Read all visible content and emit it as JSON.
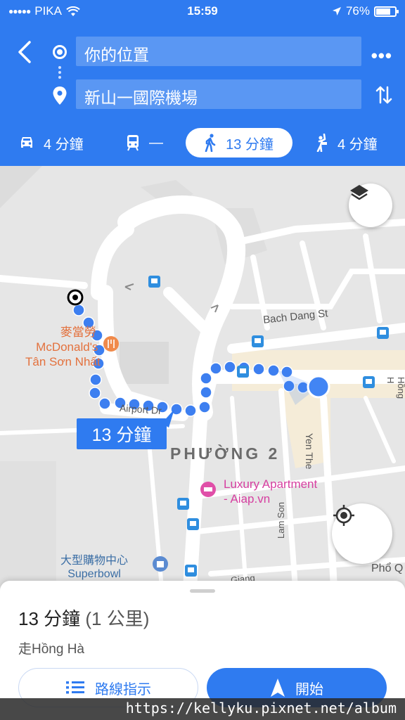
{
  "status_bar": {
    "carrier": "PIKA",
    "time": "15:59",
    "battery": "76%",
    "battery_level": 0.76
  },
  "header": {
    "origin": "你的位置",
    "destination": "新山一國際機場",
    "back_icon": "chevron-left-icon",
    "more_icon": "more-horizontal-icon",
    "swap_icon": "swap-vertical-icon"
  },
  "modes": [
    {
      "icon": "car-icon",
      "label": "4 分鐘"
    },
    {
      "icon": "transit-icon",
      "label": "—"
    },
    {
      "icon": "walk-icon",
      "label": "13 分鐘",
      "selected": true
    },
    {
      "icon": "ride-hailing-icon",
      "label": "4 分鐘"
    }
  ],
  "map": {
    "route_duration": "13 分鐘",
    "streets": [
      "Bach Dang St",
      "Airport Dr",
      "Yen The",
      "Lam Son",
      "Giang",
      "Hồng H"
    ],
    "district": "PHƯỜNG 2",
    "pois": [
      {
        "name": "麥當勞",
        "sub1": "McDonald's",
        "sub2": "Tân Sơn Nhất"
      },
      {
        "name": "Luxury Apartment",
        "sub1": "- Aiap.vn"
      },
      {
        "name": "大型購物中心",
        "sub1": "Superbowl"
      },
      {
        "name": "Phổ Q"
      }
    ],
    "colors": {
      "route": "#3d7ff0",
      "current_location": "#4285f4"
    }
  },
  "sheet": {
    "duration": "13 分鐘",
    "distance": "(1 公里)",
    "via": "走Hồng Hà",
    "steps_label": "路線指示",
    "start_label": "開始"
  },
  "watermark": "https://kellyku.pixnet.net/album",
  "colors": {
    "accent": "#2f7bf0"
  }
}
